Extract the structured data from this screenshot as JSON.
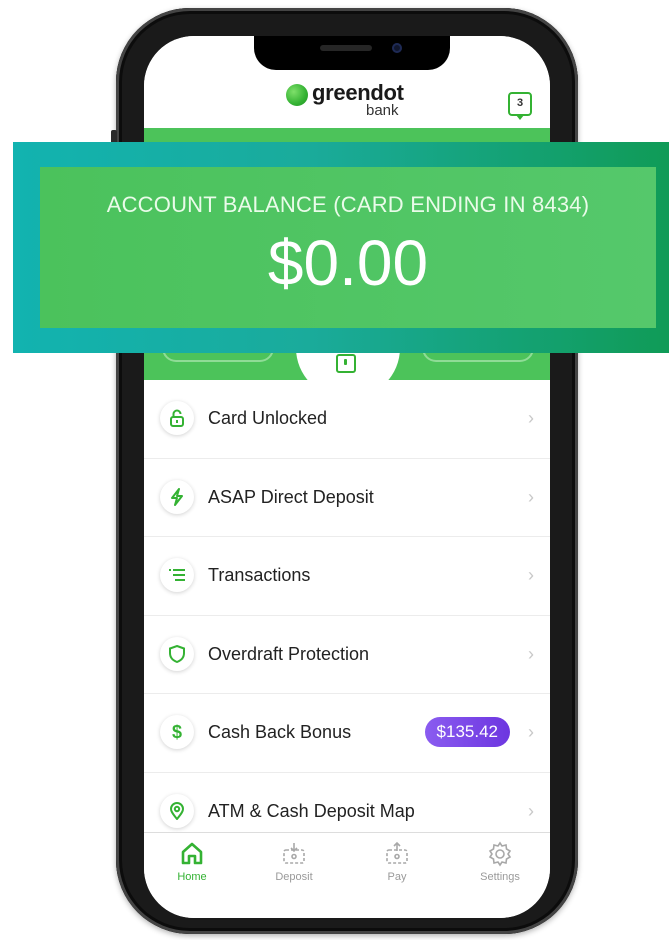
{
  "header": {
    "logo_word": "greendot",
    "logo_sub": "bank",
    "inbox_count": "3"
  },
  "banner": {
    "title": "ACCOUNT BALANCE (CARD ENDING IN 8434)",
    "amount": "$0.00"
  },
  "menu": {
    "items": [
      {
        "label": "Card Unlocked",
        "icon": "lock-icon"
      },
      {
        "label": "ASAP Direct Deposit",
        "icon": "lightning-icon"
      },
      {
        "label": "Transactions",
        "icon": "list-icon"
      },
      {
        "label": "Overdraft Protection",
        "icon": "shield-icon"
      },
      {
        "label": "Cash Back Bonus",
        "icon": "dollar-icon",
        "badge": "$135.42"
      },
      {
        "label": "ATM & Cash Deposit Map",
        "icon": "map-pin-icon"
      }
    ]
  },
  "tabs": [
    {
      "label": "Home",
      "icon": "home-icon",
      "active": true
    },
    {
      "label": "Deposit",
      "icon": "deposit-icon"
    },
    {
      "label": "Pay",
      "icon": "pay-icon"
    },
    {
      "label": "Settings",
      "icon": "gear-icon"
    }
  ],
  "colors": {
    "brand_green": "#34b233",
    "badge_purple": "#7a48e8",
    "banner_teal": "#12b3b0"
  }
}
